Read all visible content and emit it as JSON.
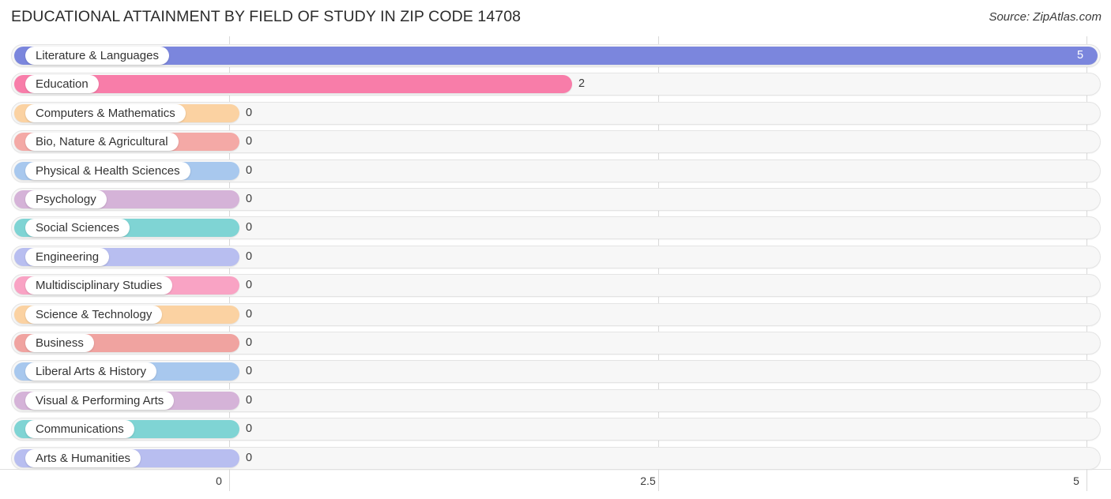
{
  "header": {
    "title": "EDUCATIONAL ATTAINMENT BY FIELD OF STUDY IN ZIP CODE 14708",
    "source": "Source: ZipAtlas.com"
  },
  "chart_data": {
    "type": "bar",
    "orientation": "horizontal",
    "title": "EDUCATIONAL ATTAINMENT BY FIELD OF STUDY IN ZIP CODE 14708",
    "xlabel": "",
    "ylabel": "",
    "xlim": [
      0,
      5
    ],
    "xticks": [
      "0",
      "2.5",
      "5"
    ],
    "xtick_values": [
      0,
      2.5,
      5
    ],
    "grid": true,
    "legend": false,
    "categories": [
      "Literature & Languages",
      "Education",
      "Computers & Mathematics",
      "Bio, Nature & Agricultural",
      "Physical & Health Sciences",
      "Psychology",
      "Social Sciences",
      "Engineering",
      "Multidisciplinary Studies",
      "Science & Technology",
      "Business",
      "Liberal Arts & History",
      "Visual & Performing Arts",
      "Communications",
      "Arts & Humanities"
    ],
    "values": [
      5,
      2,
      0,
      0,
      0,
      0,
      0,
      0,
      0,
      0,
      0,
      0,
      0,
      0,
      0
    ],
    "value_labels": [
      "5",
      "2",
      "0",
      "0",
      "0",
      "0",
      "0",
      "0",
      "0",
      "0",
      "0",
      "0",
      "0",
      "0",
      "0"
    ],
    "colors": [
      "#7b86dd",
      "#f87da9",
      "#fbd2a2",
      "#f4a9a6",
      "#a8c8ee",
      "#d5b3d8",
      "#7fd4d4",
      "#b8bef0",
      "#f9a3c4",
      "#fbd2a2",
      "#f0a3a0",
      "#a8c8ee",
      "#d5b3d8",
      "#7fd4d4",
      "#b8bef0"
    ]
  }
}
